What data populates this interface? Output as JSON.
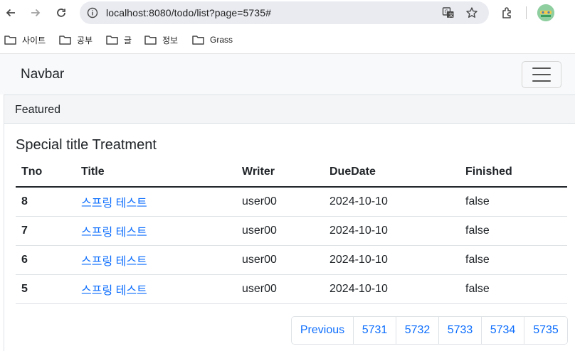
{
  "browser": {
    "url": "localhost:8080/todo/list?page=5735#",
    "bookmarks": [
      {
        "label": "사이트"
      },
      {
        "label": "공부"
      },
      {
        "label": "글"
      },
      {
        "label": "정보"
      },
      {
        "label": "Grass"
      }
    ]
  },
  "navbar": {
    "brand": "Navbar"
  },
  "card": {
    "header": "Featured",
    "title": "Special title Treatment"
  },
  "table": {
    "columns": [
      "Tno",
      "Title",
      "Writer",
      "DueDate",
      "Finished"
    ],
    "rows": [
      {
        "tno": "8",
        "title": "스프링 테스트",
        "writer": "user00",
        "dueDate": "2024-10-10",
        "finished": "false"
      },
      {
        "tno": "7",
        "title": "스프링 테스트",
        "writer": "user00",
        "dueDate": "2024-10-10",
        "finished": "false"
      },
      {
        "tno": "6",
        "title": "스프링 테스트",
        "writer": "user00",
        "dueDate": "2024-10-10",
        "finished": "false"
      },
      {
        "tno": "5",
        "title": "스프링 테스트",
        "writer": "user00",
        "dueDate": "2024-10-10",
        "finished": "false"
      }
    ]
  },
  "pagination": {
    "previous": "Previous",
    "pages": [
      "5731",
      "5732",
      "5733",
      "5734",
      "5735"
    ]
  }
}
